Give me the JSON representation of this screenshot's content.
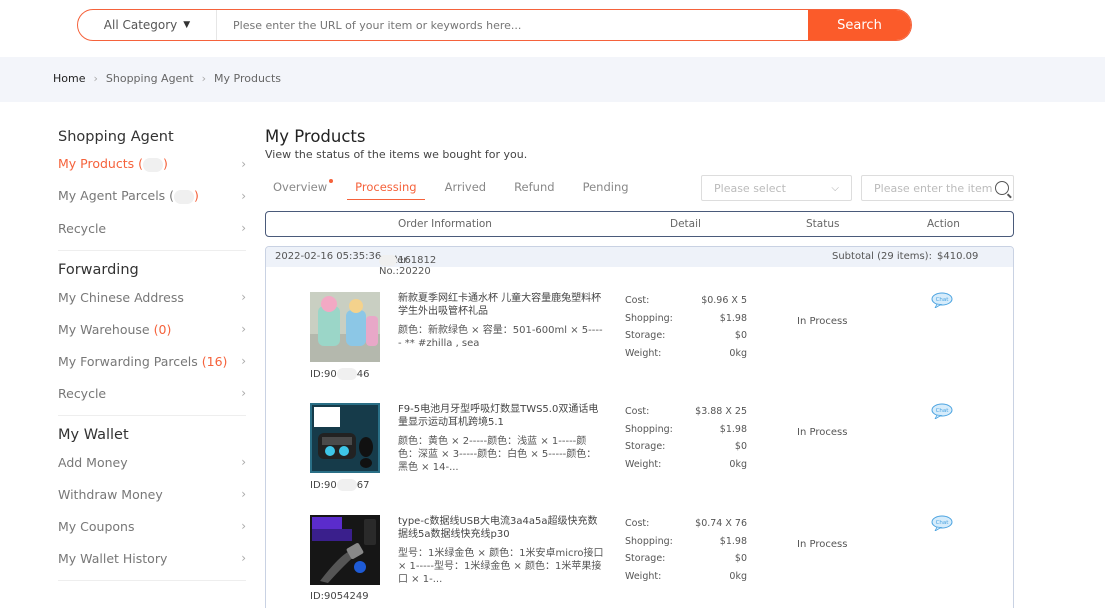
{
  "search": {
    "category": "All Category",
    "placeholder": "Plese enter the URL of your item or keywords here...",
    "button": "Search"
  },
  "breadcrumb": [
    "Home",
    "Shopping Agent",
    "My Products"
  ],
  "sidebar": {
    "sections": [
      {
        "title": "Shopping Agent",
        "items": [
          {
            "label": "My Products (",
            "count_suffix": ")",
            "active": true
          },
          {
            "label": "My Agent Parcels (",
            "count_suffix": ")"
          },
          {
            "label": "Recycle"
          }
        ]
      },
      {
        "title": "Forwarding",
        "items": [
          {
            "label": "My Chinese Address"
          },
          {
            "label": "My Warehouse",
            "count": "(0)"
          },
          {
            "label": "My Forwarding Parcels",
            "count": "(16)"
          },
          {
            "label": "Recycle"
          }
        ]
      },
      {
        "title": "My Wallet",
        "items": [
          {
            "label": "Add Money"
          },
          {
            "label": "Withdraw Money"
          },
          {
            "label": "My Coupons"
          },
          {
            "label": "My Wallet History"
          }
        ]
      }
    ]
  },
  "main": {
    "title": "My Products",
    "subtitle": "View the status of the items we bought for you.",
    "tabs": [
      "Overview",
      "Processing",
      "Arrived",
      "Refund",
      "Pending"
    ],
    "active_tab": "Processing",
    "filter_placeholder": "Please select",
    "item_search_placeholder": "Please enter the item ID",
    "columns": [
      "Order Information",
      "Detail",
      "Status",
      "Action"
    ],
    "order": {
      "date": "2022-02-16 05:35:36",
      "order_no_prefix": "Order No.:20220",
      "order_no_mid": "322161812",
      "subtotal_label": "Subtotal (29 items):",
      "subtotal_value": "$410.09"
    },
    "cost_labels": [
      "Cost:",
      "Shopping:",
      "Storage:",
      "Weight:"
    ],
    "chat_label": "Chat",
    "products": [
      {
        "title": "新款夏季网红卡通水杯 儿童大容量鹿兔塑料杯学生外出吸管杯礼品",
        "spec": "颜色：新款绿色 × 容量：501-600ml × 5----- ** #zhilla , sea",
        "id_prefix": "ID:90",
        "id_suffix": "46",
        "cost": "$0.96 X 5",
        "shopping": "$1.98",
        "storage": "$0",
        "weight": "0kg",
        "status": "In Process"
      },
      {
        "title": "F9-5电池月牙型呼吸灯数显TWS5.0双通话电量显示运动耳机跨境5.1",
        "spec": "颜色：黄色 × 2-----颜色：浅蓝 × 1-----颜色：深蓝 × 3-----颜色：白色 × 5-----颜色：黑色 × 14-...",
        "id_prefix": "ID:90",
        "id_suffix": "67",
        "cost": "$3.88 X 25",
        "shopping": "$1.98",
        "storage": "$0",
        "weight": "0kg",
        "status": "In Process"
      },
      {
        "title": "type-c数据线USB大电流3a4a5a超级快充数据线5a数据线快充线p30",
        "spec": "型号：1米绿金色 × 颜色：1米安卓micro接口 × 1-----型号：1米绿金色 × 颜色：1米苹果接口 × 1-...",
        "id_prefix": "ID:9054249",
        "id_suffix": "",
        "cost": "$0.74 X 76",
        "shopping": "$1.98",
        "storage": "$0",
        "weight": "0kg",
        "status": "In Process"
      }
    ]
  },
  "colors": {
    "accent": "#f5623b",
    "search_button": "#fb5b2a",
    "breadcrumb_bg": "#f3f5fa",
    "order_head_bg": "#eef2f9"
  }
}
